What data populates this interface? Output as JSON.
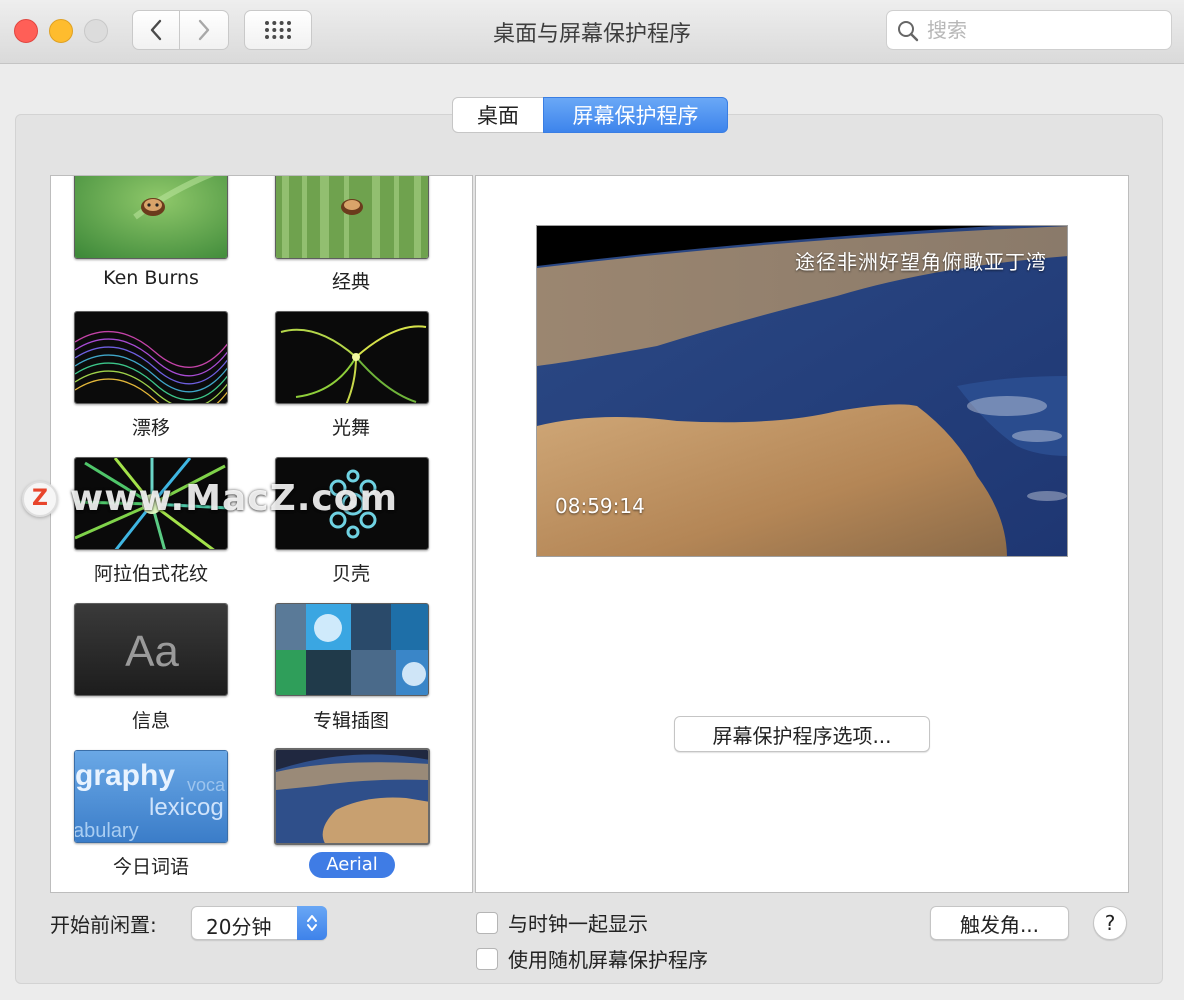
{
  "window": {
    "title": "桌面与屏幕保护程序",
    "search_placeholder": "搜索"
  },
  "tabs": [
    {
      "label": "桌面",
      "selected": false
    },
    {
      "label": "屏幕保护程序",
      "selected": true
    }
  ],
  "savers": [
    {
      "label": "Ken Burns",
      "icon": "ladybug-photo"
    },
    {
      "label": "经典",
      "icon": "ladybug-bamboo"
    },
    {
      "label": "漂移",
      "icon": "drift-waves"
    },
    {
      "label": "光舞",
      "icon": "flurry-lights"
    },
    {
      "label": "阿拉伯式花纹",
      "icon": "arabesque-burst"
    },
    {
      "label": "贝壳",
      "icon": "shell-swirl"
    },
    {
      "label": "信息",
      "icon": "message-aa",
      "thumb_text": "Aa"
    },
    {
      "label": "专辑插图",
      "icon": "album-artwork"
    },
    {
      "label": "今日词语",
      "icon": "word-of-the-day",
      "thumb_words": [
        "graphy",
        "lexicog",
        "abulary",
        "voca"
      ]
    },
    {
      "label": "Aerial",
      "icon": "aerial-earth",
      "selected": true
    }
  ],
  "preview": {
    "caption": "途径非洲好望角俯瞰亚丁湾",
    "time": "08:59:14"
  },
  "options_button": "屏幕保护程序选项...",
  "idle": {
    "label": "开始前闲置:",
    "value": "20分钟"
  },
  "checkboxes": [
    {
      "label": "与时钟一起显示",
      "checked": false
    },
    {
      "label": "使用随机屏幕保护程序",
      "checked": false
    }
  ],
  "hot_corners_button": "触发角...",
  "help_button": "?",
  "watermark": {
    "badge": "Z",
    "text": "www.MacZ.com"
  },
  "colors": {
    "accent": "#3f7ce5",
    "close": "#ff5f57",
    "minimize": "#febc2e"
  }
}
